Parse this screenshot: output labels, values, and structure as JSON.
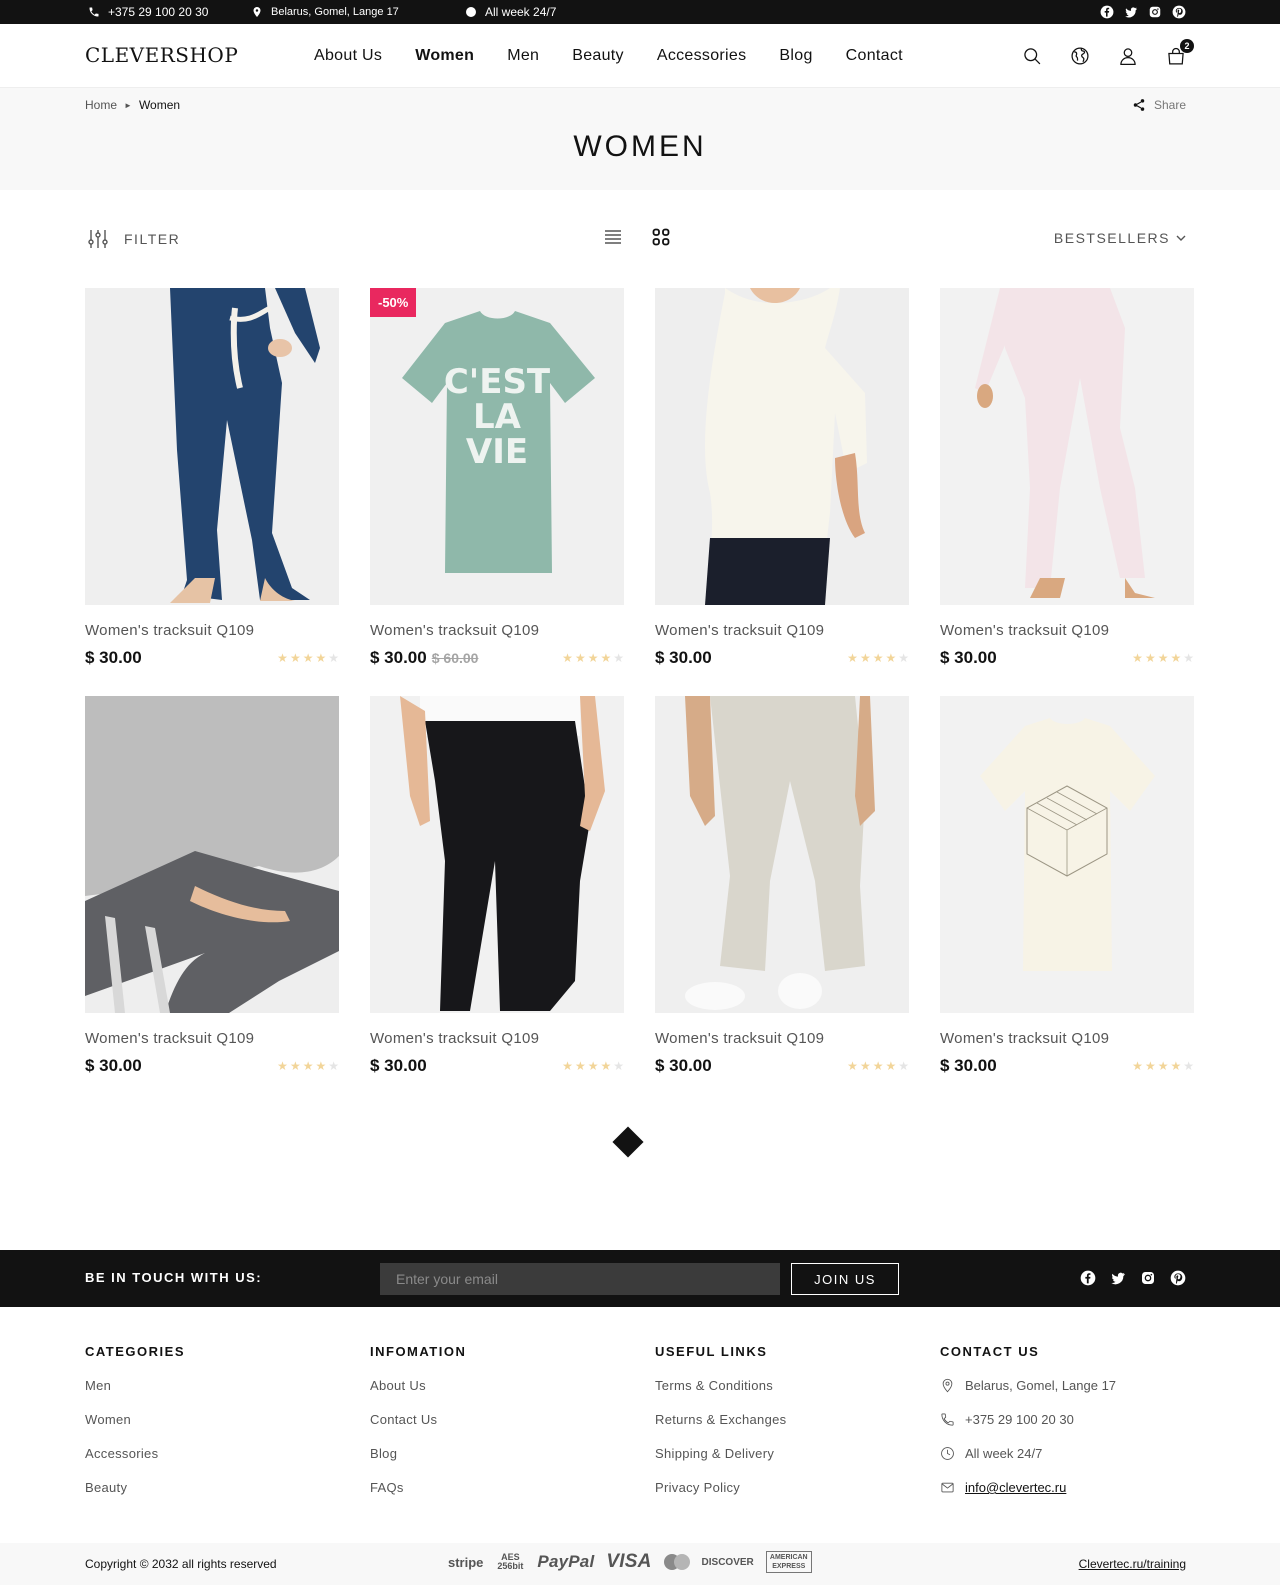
{
  "topbar": {
    "phone": "+375 29 100 20 30",
    "address": "Belarus, Gomel, Lange 17",
    "hours": "All week 24/7",
    "social": [
      "facebook-icon",
      "twitter-icon",
      "instagram-icon",
      "pinterest-icon"
    ]
  },
  "header": {
    "logo": "CLEVERSHOP",
    "nav": [
      "About Us",
      "Women",
      "Men",
      "Beauty",
      "Accessories",
      "Blog",
      "Contact"
    ],
    "active_nav": "Women",
    "cart_count": "2",
    "icons": [
      "search-icon",
      "globe-icon",
      "user-icon",
      "cart-icon"
    ]
  },
  "band": {
    "breadcrumb": [
      "Home",
      "Women"
    ],
    "share": "Share",
    "title": "WOMEN"
  },
  "toolbar": {
    "filter": "FILTER",
    "sort": "BESTSELLERS"
  },
  "products": [
    {
      "name": "Women's tracksuit Q109",
      "price": "$ 30.00",
      "old_price": "",
      "badge": "",
      "rating": 4
    },
    {
      "name": "Women's tracksuit Q109",
      "price": "$ 30.00",
      "old_price": "$ 60.00",
      "badge": "-50%",
      "rating": 4
    },
    {
      "name": "Women's tracksuit Q109",
      "price": "$ 30.00",
      "old_price": "",
      "badge": "",
      "rating": 4
    },
    {
      "name": "Women's tracksuit Q109",
      "price": "$ 30.00",
      "old_price": "",
      "badge": "",
      "rating": 4
    },
    {
      "name": "Women's tracksuit Q109",
      "price": "$ 30.00",
      "old_price": "",
      "badge": "",
      "rating": 4
    },
    {
      "name": "Women's tracksuit Q109",
      "price": "$ 30.00",
      "old_price": "",
      "badge": "",
      "rating": 4
    },
    {
      "name": "Women's tracksuit Q109",
      "price": "$ 30.00",
      "old_price": "",
      "badge": "",
      "rating": 4
    },
    {
      "name": "Women's tracksuit Q109",
      "price": "$ 30.00",
      "old_price": "",
      "badge": "",
      "rating": 4
    }
  ],
  "shirt_text": "C'EST LA VIE",
  "subscribe": {
    "label": "BE IN TOUCH WITH US:",
    "placeholder": "Enter your email",
    "button": "JOIN US"
  },
  "footer": {
    "categories": {
      "title": "CATEGORIES",
      "links": [
        "Men",
        "Women",
        "Accessories",
        "Beauty"
      ]
    },
    "information": {
      "title": "INFOMATION",
      "links": [
        "About Us",
        "Contact Us",
        "Blog",
        "FAQs"
      ]
    },
    "useful": {
      "title": "USEFUL LINKS",
      "links": [
        "Terms & Conditions",
        "Returns & Exchanges",
        "Shipping & Delivery",
        "Privacy Policy"
      ]
    },
    "contact": {
      "title": "CONTACT US",
      "address": "Belarus, Gomel, Lange 17",
      "phone": "+375 29 100 20 30",
      "hours": "All week 24/7",
      "email": "info@clevertec.ru"
    }
  },
  "bottom": {
    "copyright": "Copyright © 2032 all rights reserved",
    "payments": [
      "stripe",
      "AES 256bit",
      "PayPal",
      "VISA",
      "MasterCard",
      "DISCOVER",
      "AMERICAN EXPRESS"
    ],
    "site_link": "Clevertec.ru/training"
  },
  "colors": {
    "accent": "#e9285f",
    "dark": "#121212",
    "star": "#f2d599",
    "band": "#f8f8f8"
  }
}
